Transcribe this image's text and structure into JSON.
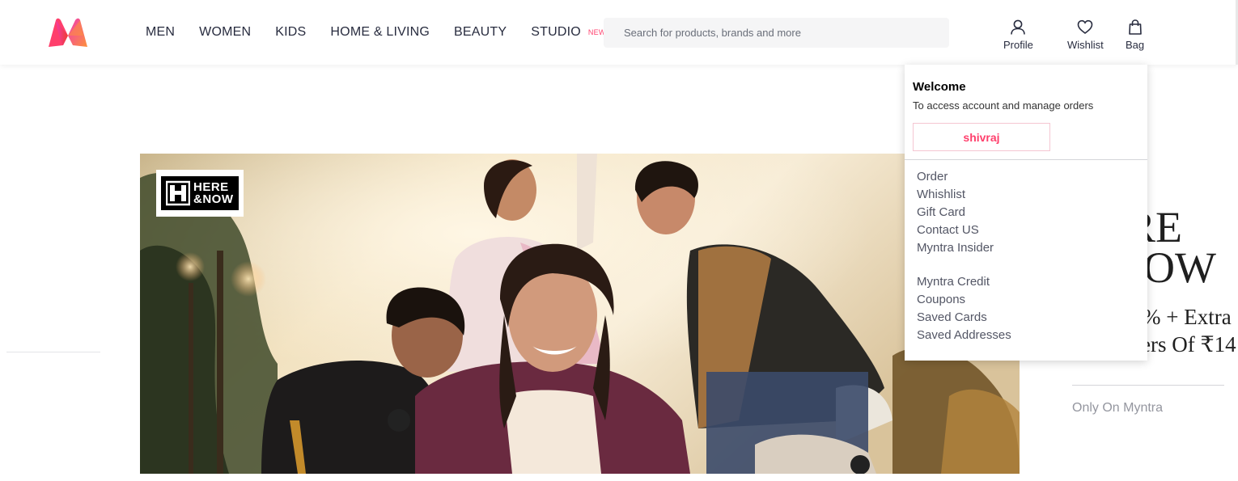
{
  "header": {
    "logo_name": "myntra-logo",
    "nav": [
      {
        "label": "MEN"
      },
      {
        "label": "WOMEN"
      },
      {
        "label": "KIDS"
      },
      {
        "label": "HOME & LIVING"
      },
      {
        "label": "BEAUTY"
      },
      {
        "label": "STUDIO",
        "badge": "NEW"
      }
    ],
    "search": {
      "placeholder": "Search for products, brands and more",
      "value": ""
    },
    "actions": [
      {
        "label": "Profile",
        "icon": "user-icon"
      },
      {
        "label": "Wishlist",
        "icon": "heart-icon"
      },
      {
        "label": "Bag",
        "icon": "bag-icon"
      }
    ]
  },
  "banner": {
    "brand_logo_text": "HERE\n&NOW"
  },
  "promo": {
    "line1": "RE",
    "line2": "OW",
    "line3": "% + Extra",
    "line4": "ers Of ₹14",
    "footer": "Only On Myntra"
  },
  "profile_menu": {
    "title": "Welcome",
    "subtitle": "To access account and manage orders",
    "user_button": "shivraj",
    "group1": [
      "Order",
      "Whishlist",
      "Gift Card",
      "Contact US",
      "Myntra Insider"
    ],
    "group2": [
      "Myntra Credit",
      "Coupons",
      "Saved Cards",
      "Saved Addresses"
    ]
  },
  "colors": {
    "accent": "#ff3f6c",
    "text": "#282c3f",
    "search_bg": "#f5f5f6",
    "menu_text": "#535665"
  }
}
